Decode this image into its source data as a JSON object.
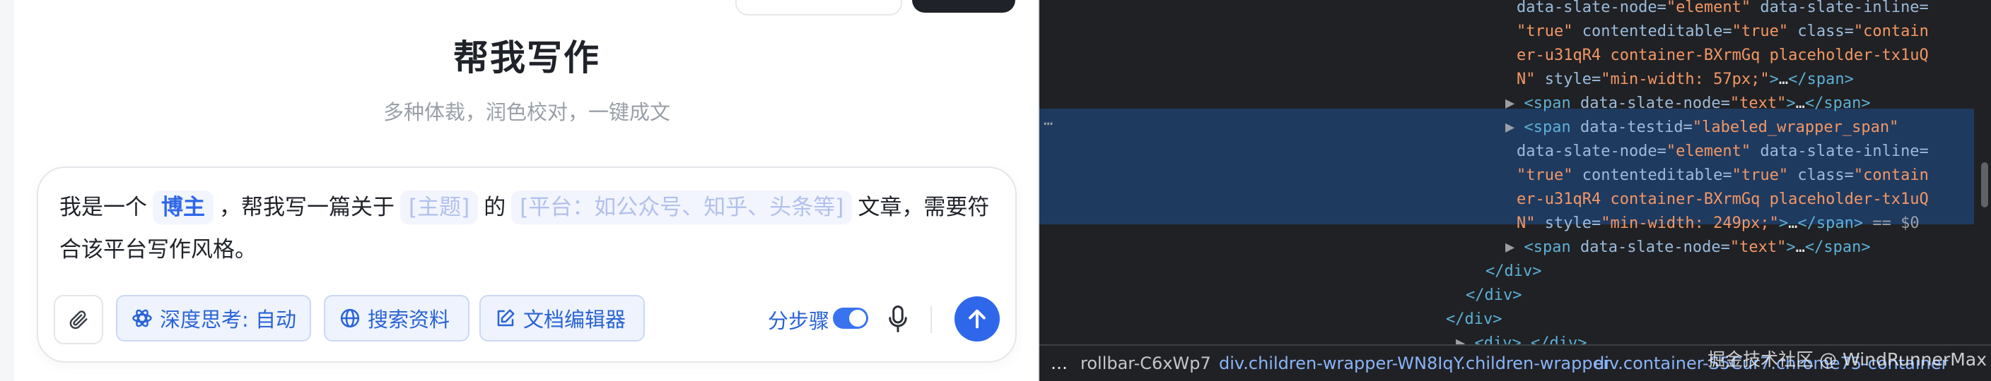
{
  "app": {
    "title": "帮我写作",
    "subtitle": "多种体裁，润色校对，一键成文",
    "prompt": {
      "p1": "我是一个",
      "slot_role": "博主",
      "p2": "，帮我写一篇关于",
      "slot_topic": "[主题]",
      "p3": "的",
      "slot_platform": "[平台：如公众号、知乎、头条等]",
      "p4": "文章，需要符合该平台写作风格。"
    },
    "toolbar": {
      "deep_think": "深度思考: 自动",
      "search": "搜索资料",
      "doc_editor": "文档编辑器",
      "step_label": "分步骤"
    },
    "colors": {
      "accent": "#2f67ea",
      "slot_bg": "#f2f5fd",
      "chip_border": "#cbd8f4"
    }
  },
  "devtools": {
    "lines": [
      {
        "segs": [
          [
            "a",
            "data-slate-node="
          ],
          [
            "v",
            "\"element\""
          ],
          [
            "a",
            " data-slate-inline="
          ]
        ]
      },
      {
        "segs": [
          [
            "v",
            "\"true\""
          ],
          [
            "a",
            " contenteditable="
          ],
          [
            "v",
            "\"true\""
          ],
          [
            "a",
            " class="
          ],
          [
            "v",
            "\"contain"
          ]
        ]
      },
      {
        "segs": [
          [
            "v",
            "er-u31qR4 container-BXrmGq placeholder-tx1uQ"
          ]
        ]
      },
      {
        "segs": [
          [
            "v",
            "N\""
          ],
          [
            "a",
            " style="
          ],
          [
            "v",
            "\"min-width: 57px;\""
          ],
          [
            "t",
            ">"
          ],
          [
            "p",
            "…"
          ],
          [
            "t",
            "</span>"
          ]
        ]
      },
      {
        "segs": [
          [
            "tri",
            "▶ "
          ],
          [
            "t",
            "<span"
          ],
          [
            "a",
            " data-slate-node="
          ],
          [
            "v",
            "\"text\""
          ],
          [
            "t",
            ">"
          ],
          [
            "p",
            "…"
          ],
          [
            "t",
            "</span>"
          ]
        ]
      },
      {
        "segs": [
          [
            "tri",
            "▶ "
          ],
          [
            "t",
            "<span"
          ],
          [
            "a",
            " data-testid="
          ],
          [
            "v",
            "\"labeled_wrapper_span\""
          ]
        ]
      },
      {
        "segs": [
          [
            "a",
            "data-slate-node="
          ],
          [
            "v",
            "\"element\""
          ],
          [
            "a",
            " data-slate-inline="
          ]
        ]
      },
      {
        "segs": [
          [
            "v",
            "\"true\""
          ],
          [
            "a",
            " contenteditable="
          ],
          [
            "v",
            "\"true\""
          ],
          [
            "a",
            " class="
          ],
          [
            "v",
            "\"contain"
          ]
        ]
      },
      {
        "segs": [
          [
            "v",
            "er-u31qR4 container-BXrmGq placeholder-tx1uQ"
          ]
        ]
      },
      {
        "segs": [
          [
            "v",
            "N\""
          ],
          [
            "a",
            " style="
          ],
          [
            "v",
            "\"min-width: 249px;\""
          ],
          [
            "t",
            ">"
          ],
          [
            "p",
            "…"
          ],
          [
            "t",
            "</span>"
          ],
          [
            "g",
            " == $0"
          ]
        ]
      },
      {
        "segs": [
          [
            "tri",
            "▶ "
          ],
          [
            "t",
            "<span"
          ],
          [
            "a",
            " data-slate-node="
          ],
          [
            "v",
            "\"text\""
          ],
          [
            "t",
            ">"
          ],
          [
            "p",
            "…"
          ],
          [
            "t",
            "</span>"
          ]
        ]
      },
      {
        "segs": [
          [
            "t",
            "</div>"
          ]
        ]
      },
      {
        "segs": [
          [
            "t",
            "</div>"
          ]
        ]
      },
      {
        "segs": [
          [
            "t",
            "</div>"
          ]
        ]
      },
      {
        "segs": [
          [
            "tri",
            "▶ "
          ],
          [
            "t",
            "<div>"
          ],
          [
            "p",
            "…"
          ],
          [
            "t",
            "</div>"
          ]
        ]
      }
    ],
    "gutter_dots": "…",
    "breadcrumbs": {
      "dots": "…",
      "c1": "rollbar-C6xWp7",
      "c2": "div.children-wrapper-WN8IqY.children-wrapper",
      "c3": "div.container-S5Cur7.chrome75-container"
    },
    "watermark": "掘金技术社区 @ WindRunnerMax"
  }
}
